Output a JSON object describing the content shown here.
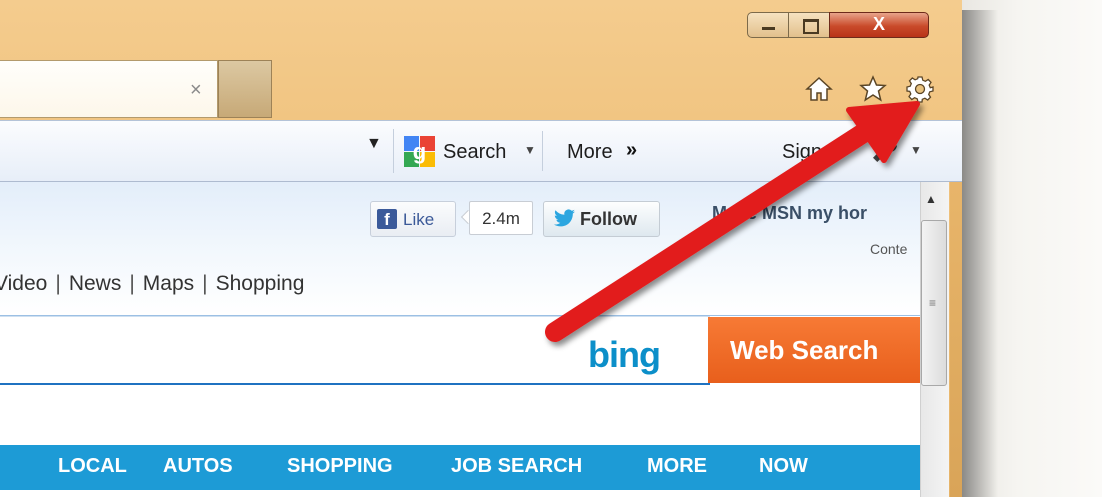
{
  "window": {
    "tab_close_glyph": "×",
    "minimize_glyph": "",
    "maximize_glyph": "",
    "close_glyph": "X"
  },
  "toolbar": {
    "home_icon": "home-icon",
    "favorites_icon": "star-icon",
    "tools_icon": "gear-icon"
  },
  "command_bar": {
    "dropdown_glyph": "▼",
    "search_label": "Search",
    "search_dropdown_glyph": "▼",
    "more_label": "More",
    "more_chevron": "»",
    "signin_label": "Sign In",
    "signin_dropdown_glyph": "▼"
  },
  "social": {
    "like_label": "Like",
    "like_count": "2.4m",
    "follow_label": "Follow"
  },
  "header": {
    "make_home_label": "Make MSN my hor",
    "content_label": "Conte"
  },
  "nav_links": [
    "Video",
    "News",
    "Maps",
    "Shopping"
  ],
  "search": {
    "bing_logo": "bing",
    "web_search_button": "Web Search"
  },
  "categories": [
    "LOCAL",
    "AUTOS",
    "SHOPPING",
    "JOB SEARCH",
    "MORE",
    "NOW"
  ],
  "colors": {
    "arrow": "#e21b1b",
    "bing": "#0c8fc9",
    "web_search_bg": "#f26b26",
    "category_bar": "#1d9bd6"
  }
}
